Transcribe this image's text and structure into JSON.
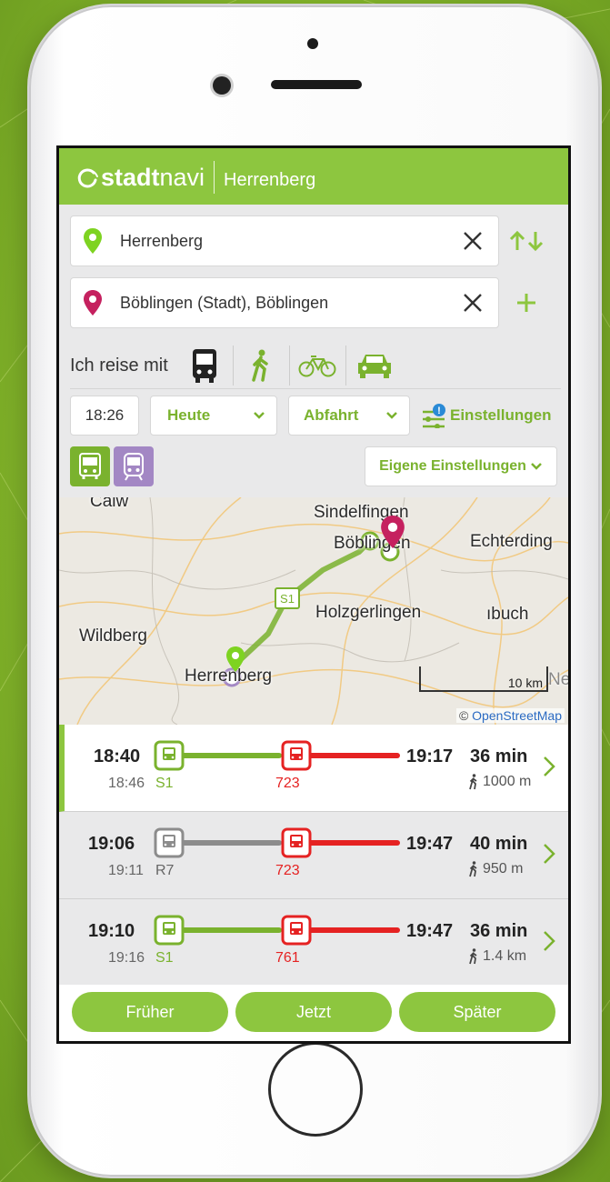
{
  "brand": {
    "logo_bold": "stadt",
    "logo_light": "navi",
    "city": "Herrenberg",
    "accent": "#8dc63f"
  },
  "origin": {
    "value": "Herrenberg",
    "pin_color": "#7ab22e"
  },
  "destination": {
    "value": "Böblingen (Stadt), Böblingen",
    "pin_color": "#c5215f"
  },
  "modes": {
    "label": "Ich reise mit",
    "items": [
      "bus-icon",
      "walk-icon",
      "bicycle-icon",
      "car-icon"
    ]
  },
  "time": {
    "value": "18:26",
    "day": "Heute",
    "type": "Abfahrt",
    "settings": "Einstellungen"
  },
  "transport_modes": [
    {
      "icon": "bus-icon",
      "color": "#7ab22e"
    },
    {
      "icon": "train-icon",
      "color": "#a387c4"
    }
  ],
  "own_settings": "Eigene Einstellungen",
  "map": {
    "labels": [
      "Calw",
      "Sindelfingen",
      "Böblingen",
      "Echterding",
      "Holzgerlingen",
      "Wildberg",
      "Herrenberg",
      "ıbuch",
      "Neck"
    ],
    "route_label": "S1",
    "scale": "10 km",
    "attribution_prefix": "©",
    "attribution": "OpenStreetMap"
  },
  "itineraries": [
    {
      "dep": "18:40",
      "board_time": "18:46",
      "line1": "S1",
      "line2": "723",
      "arr": "19:17",
      "duration": "36 min",
      "walk": "1000 m",
      "leg1_color": "#7ab22e",
      "leg2_color": "#e52222",
      "leg1_fraction": 0.52
    },
    {
      "dep": "19:06",
      "board_time": "19:11",
      "line1": "R7",
      "line2": "723",
      "arr": "19:47",
      "duration": "40 min",
      "walk": "950 m",
      "leg1_color": "#8c8c8c",
      "leg2_color": "#e52222",
      "leg1_fraction": 0.52
    },
    {
      "dep": "19:10",
      "board_time": "19:16",
      "line1": "S1",
      "line2": "761",
      "arr": "19:47",
      "duration": "36 min",
      "walk": "1.4 km",
      "leg1_color": "#7ab22e",
      "leg2_color": "#e52222",
      "leg1_fraction": 0.52
    }
  ],
  "pager": {
    "earlier": "Früher",
    "now": "Jetzt",
    "later": "Später"
  }
}
